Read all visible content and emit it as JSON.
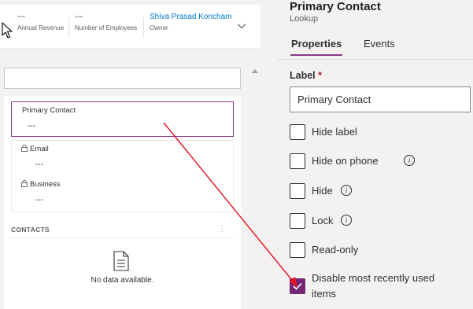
{
  "header": {
    "annual_revenue": {
      "value": "---",
      "label": "Annual Revenue"
    },
    "employees": {
      "value": "---",
      "label": "Number of Employees"
    },
    "owner": {
      "value": "Shiva Prasad Koncham",
      "label": "Owner"
    }
  },
  "form": {
    "primary_contact": {
      "label": "Primary Contact",
      "value": "---"
    },
    "email": {
      "label": "Email",
      "value": "---"
    },
    "business": {
      "label": "Business",
      "value": "---"
    },
    "contacts": {
      "title": "CONTACTS",
      "more": "⋮",
      "empty": "No data available."
    }
  },
  "pane": {
    "title": "Primary Contact",
    "subtitle": "Lookup",
    "tabs": [
      "Properties",
      "Events"
    ],
    "label_title": "Label",
    "required_mark": "*",
    "label_value": "Primary Contact",
    "options": [
      {
        "label": "Hide label",
        "checked": false,
        "info": false
      },
      {
        "label": "Hide on phone",
        "checked": false,
        "info": true
      },
      {
        "label": "Hide",
        "checked": false,
        "info": true
      },
      {
        "label": "Lock",
        "checked": false,
        "info": true
      },
      {
        "label": "Read-only",
        "checked": false,
        "info": false
      },
      {
        "label": "Disable most recently used",
        "label2": "items",
        "checked": true,
        "info": false
      }
    ]
  },
  "colors": {
    "accent": "#742774",
    "link": "#0078d4",
    "arrow": "#e81123"
  }
}
